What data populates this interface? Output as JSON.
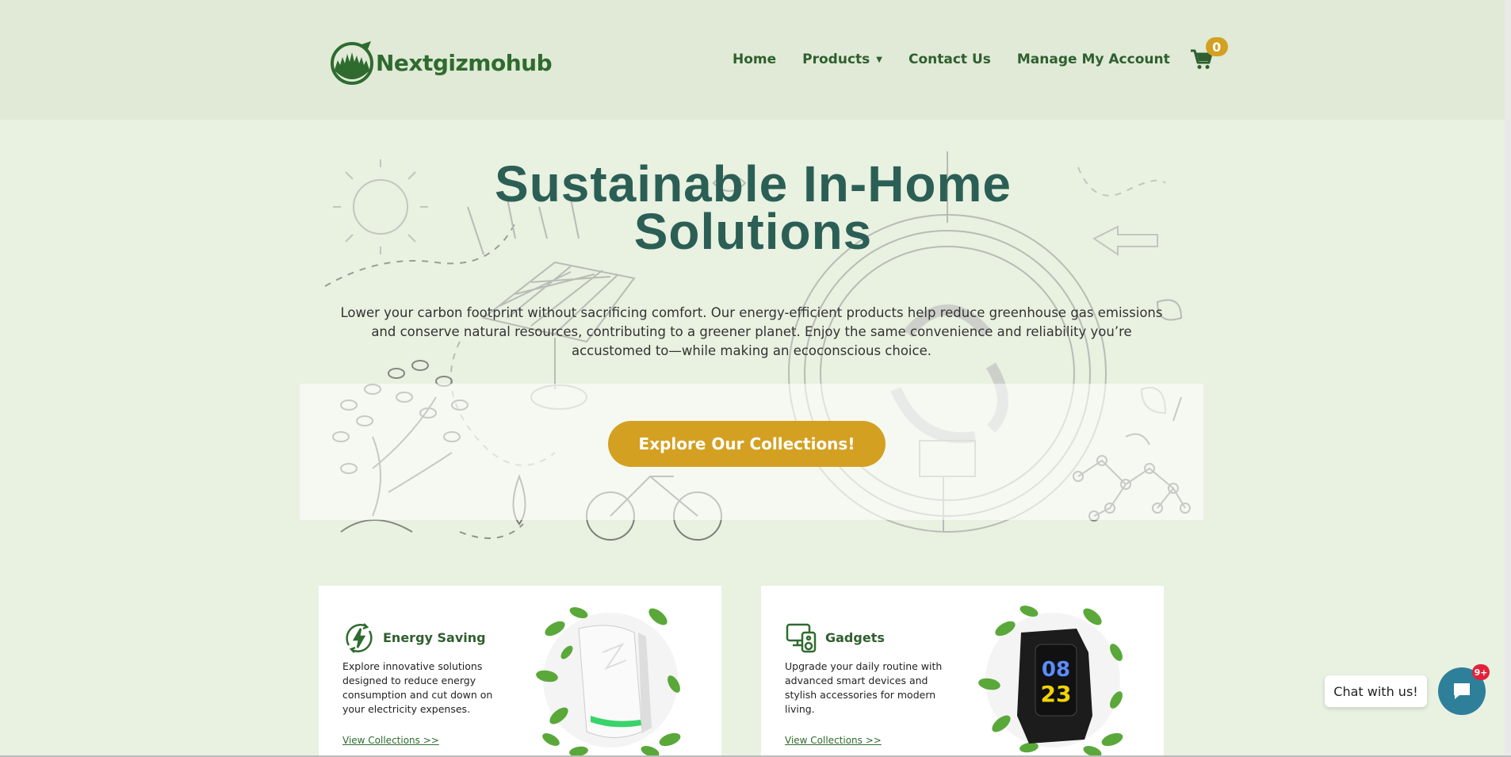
{
  "brand": {
    "name": "Nextgizmohub"
  },
  "nav": {
    "items": [
      "Home",
      "Products",
      "Contact Us",
      "Manage My Account"
    ],
    "cart_count": "0"
  },
  "hero": {
    "title_line1": "Sustainable In-Home",
    "title_line2": "Solutions",
    "description": "Lower your carbon footprint without sacrificing comfort. Our energy-efficient products help reduce greenhouse gas emissions and conserve natural resources, contributing to a greener planet. Enjoy the same convenience and reliability you’re accustomed to—while making an ecoconscious choice.",
    "cta_label": "Explore Our Collections!"
  },
  "cards": [
    {
      "title": "Energy Saving",
      "text": "Explore innovative solutions designed to reduce energy consumption and cut down on your electricity expenses.",
      "link": "View Collections >>",
      "icon": "energy-saving-icon"
    },
    {
      "title": "Gadgets",
      "text": "Upgrade your daily routine with advanced smart devices and stylish accessories for modern living.",
      "link": "View Collections >>",
      "icon": "gadgets-icon",
      "watch_time_top": "08",
      "watch_time_bottom": "23"
    }
  ],
  "chat": {
    "label": "Chat with us!",
    "badge": "9+"
  },
  "colors": {
    "header_bg": "#e0ead6",
    "page_bg": "#e9f1e1",
    "brand_green": "#2f6b2f",
    "title_teal": "#2b5f55",
    "accent_gold": "#d4a021",
    "chat_blue": "#2e7f9a"
  }
}
